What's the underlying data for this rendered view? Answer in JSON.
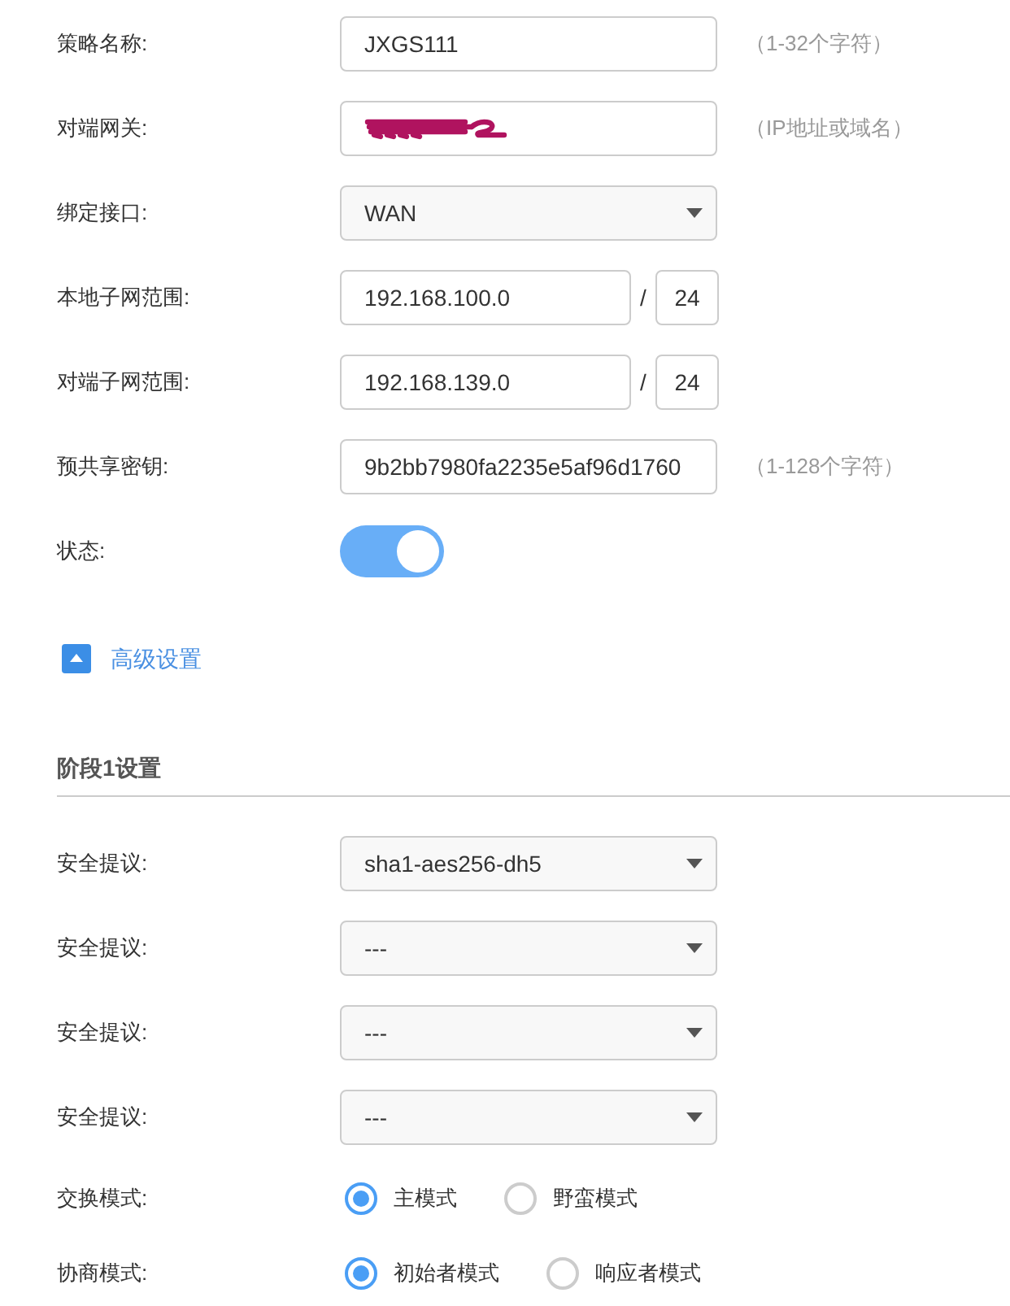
{
  "form": {
    "fields": [
      {
        "kind": "text",
        "label": "策略名称:",
        "value": "JXGS111",
        "hint": "（1-32个字符）"
      },
      {
        "kind": "redacted",
        "label": "对端网关:",
        "hint": "（IP地址或域名）"
      },
      {
        "kind": "select",
        "label": "绑定接口:",
        "value": "WAN"
      },
      {
        "kind": "subnet",
        "label": "本地子网范围:",
        "value": "192.168.100.0",
        "separator": "/",
        "mask": "24"
      },
      {
        "kind": "subnet",
        "label": "对端子网范围:",
        "value": "192.168.139.0",
        "separator": "/",
        "mask": "24"
      },
      {
        "kind": "text",
        "label": "预共享密钥:",
        "value": "9b2bb7980fa2235e5af96d1760",
        "hint": "（1-128个字符）"
      },
      {
        "kind": "switch",
        "label": "状态:",
        "on": true
      }
    ]
  },
  "advanced_settings": {
    "label": "高级设置",
    "expanded": true
  },
  "phase1": {
    "title": "阶段1设置",
    "fields": [
      {
        "kind": "select",
        "label": "安全提议:",
        "value": "sha1-aes256-dh5"
      },
      {
        "kind": "select",
        "label": "安全提议:",
        "value": "---"
      },
      {
        "kind": "select",
        "label": "安全提议:",
        "value": "---"
      },
      {
        "kind": "select",
        "label": "安全提议:",
        "value": "---"
      },
      {
        "kind": "radio",
        "label": "交换模式:",
        "options": [
          {
            "label": "主模式",
            "selected": true
          },
          {
            "label": "野蛮模式",
            "selected": false
          }
        ]
      },
      {
        "kind": "radio",
        "label": "协商模式:",
        "options": [
          {
            "label": "初始者模式",
            "selected": true
          },
          {
            "label": "响应者模式",
            "selected": false
          }
        ]
      }
    ]
  }
}
